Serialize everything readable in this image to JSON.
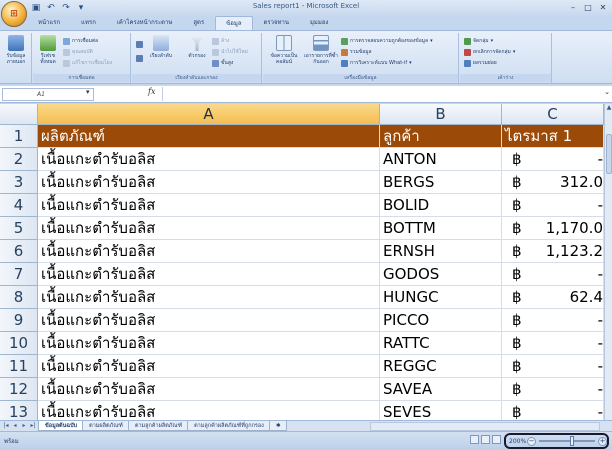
{
  "window": {
    "title": "Sales report1 - Microsoft Excel",
    "office_button_label": "⊞"
  },
  "ribbon": {
    "tabs": [
      "หน้าแรก",
      "แทรก",
      "เค้าโครงหน้ากระดาษ",
      "สูตร",
      "ข้อมูล",
      "ตรวจทาน",
      "มุมมอง"
    ],
    "active_tab": "ข้อมูล",
    "groups": {
      "external": {
        "label": "",
        "btn": "รับข้อมูลภายนอก"
      },
      "connections": {
        "label": "การเชื่อมต่อ",
        "refresh": "รีเฟรชทั้งหมด",
        "items": [
          "การเชื่อมต่อ",
          "คุณสมบัติ",
          "แก้ไขการเชื่อมโยง"
        ]
      },
      "sort": {
        "label": "เรียงลำดับและกรอง",
        "sort": "เรียงลำดับ",
        "filter": "ตัวกรอง",
        "items": [
          "ล้าง",
          "นำไปใช้ใหม่",
          "ขั้นสูง"
        ]
      },
      "tools": {
        "label": "เครื่องมือข้อมูล",
        "text_to_cols": "ข้อความเป็นคอลัมน์",
        "remove_dup": "เอารายการที่ซ้ำกันออก",
        "items": [
          "การตรวจสอบความถูกต้องของข้อมูล",
          "รวมข้อมูล",
          "การวิเคราะห์แบบ What-if"
        ]
      },
      "outline": {
        "label": "เค้าร่าง",
        "items": [
          "จัดกลุ่ม",
          "ยกเลิกการจัดกลุ่ม",
          "ผลรวมย่อย"
        ]
      }
    }
  },
  "formula_bar": {
    "name_box": "A1",
    "fx": "fx",
    "value": ""
  },
  "grid": {
    "columns": [
      "A",
      "B",
      "C"
    ],
    "selected_column": "A",
    "headers": {
      "row_number": "1",
      "product": "ผลิตภัณฑ์",
      "customer": "ลูกค้า",
      "quarter": "ไตรมาส 1"
    },
    "currency_symbol": "฿",
    "rows": [
      {
        "num": "2",
        "product": "เนื้อแกะตำรับอลิส",
        "customer": "ANTON",
        "amount": "-"
      },
      {
        "num": "3",
        "product": "เนื้อแกะตำรับอลิส",
        "customer": "BERGS",
        "amount": "312.0"
      },
      {
        "num": "4",
        "product": "เนื้อแกะตำรับอลิส",
        "customer": "BOLID",
        "amount": "-"
      },
      {
        "num": "5",
        "product": "เนื้อแกะตำรับอลิส",
        "customer": "BOTTM",
        "amount": "1,170.0"
      },
      {
        "num": "6",
        "product": "เนื้อแกะตำรับอลิส",
        "customer": "ERNSH",
        "amount": "1,123.2"
      },
      {
        "num": "7",
        "product": "เนื้อแกะตำรับอลิส",
        "customer": "GODOS",
        "amount": "-"
      },
      {
        "num": "8",
        "product": "เนื้อแกะตำรับอลิส",
        "customer": "HUNGC",
        "amount": "62.4"
      },
      {
        "num": "9",
        "product": "เนื้อแกะตำรับอลิส",
        "customer": "PICCO",
        "amount": "-"
      },
      {
        "num": "10",
        "product": "เนื้อแกะตำรับอลิส",
        "customer": "RATTC",
        "amount": "-"
      },
      {
        "num": "11",
        "product": "เนื้อแกะตำรับอลิส",
        "customer": "REGGC",
        "amount": "-"
      },
      {
        "num": "12",
        "product": "เนื้อแกะตำรับอลิส",
        "customer": "SAVEA",
        "amount": "-"
      },
      {
        "num": "13",
        "product": "เนื้อแกะตำรับอลิส",
        "customer": "SEVES",
        "amount": "-"
      }
    ]
  },
  "sheets": {
    "tabs": [
      "ข้อมูลต้นฉบับ",
      "ตามผลิตภัณฑ์",
      "ตามลูกค้าผลิตภัณฑ์",
      "ตามลูกค้าผลิตภัณฑ์ที่ถูกกรอง"
    ],
    "active": "ข้อมูลต้นฉบับ"
  },
  "status_bar": {
    "ready": "พร้อม",
    "zoom": "200%",
    "zoom_fraction": 0.6
  },
  "colors": {
    "header_fill": "#9c4a08",
    "selected_header": "#f4be4f",
    "ribbon": "#cfdef2"
  }
}
